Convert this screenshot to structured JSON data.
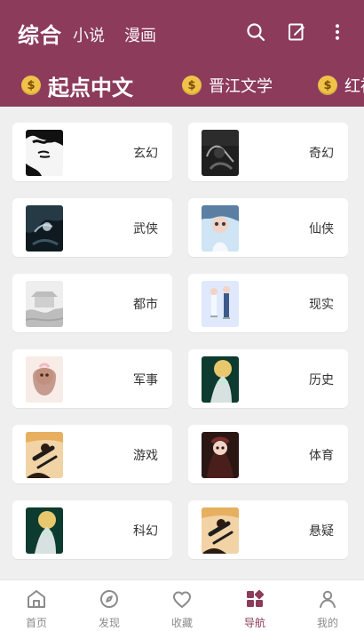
{
  "header": {
    "tabs": [
      {
        "label": "综合",
        "active": true
      },
      {
        "label": "小说",
        "active": false
      },
      {
        "label": "漫画",
        "active": false
      }
    ],
    "icons": [
      "search-icon",
      "edit-icon",
      "more-vertical-icon"
    ],
    "sources": [
      {
        "label": "起点中文",
        "active": true,
        "icon": "money-bag-icon"
      },
      {
        "label": "晋江文学",
        "active": false,
        "icon": "money-bag-icon"
      },
      {
        "label": "红袖",
        "active": false,
        "icon": "money-bag-icon"
      }
    ],
    "accent": "#8c3b5b"
  },
  "categories": [
    {
      "label": "玄幻"
    },
    {
      "label": "奇幻"
    },
    {
      "label": "武侠"
    },
    {
      "label": "仙侠"
    },
    {
      "label": "都市"
    },
    {
      "label": "现实"
    },
    {
      "label": "军事"
    },
    {
      "label": "历史"
    },
    {
      "label": "游戏"
    },
    {
      "label": "体育"
    },
    {
      "label": "科幻"
    },
    {
      "label": "悬疑"
    }
  ],
  "bottom_nav": [
    {
      "label": "首页",
      "icon": "home-icon",
      "active": false
    },
    {
      "label": "发现",
      "icon": "compass-icon",
      "active": false
    },
    {
      "label": "收藏",
      "icon": "heart-icon",
      "active": false
    },
    {
      "label": "导航",
      "icon": "grid-icon",
      "active": true
    },
    {
      "label": "我的",
      "icon": "user-icon",
      "active": false
    }
  ]
}
